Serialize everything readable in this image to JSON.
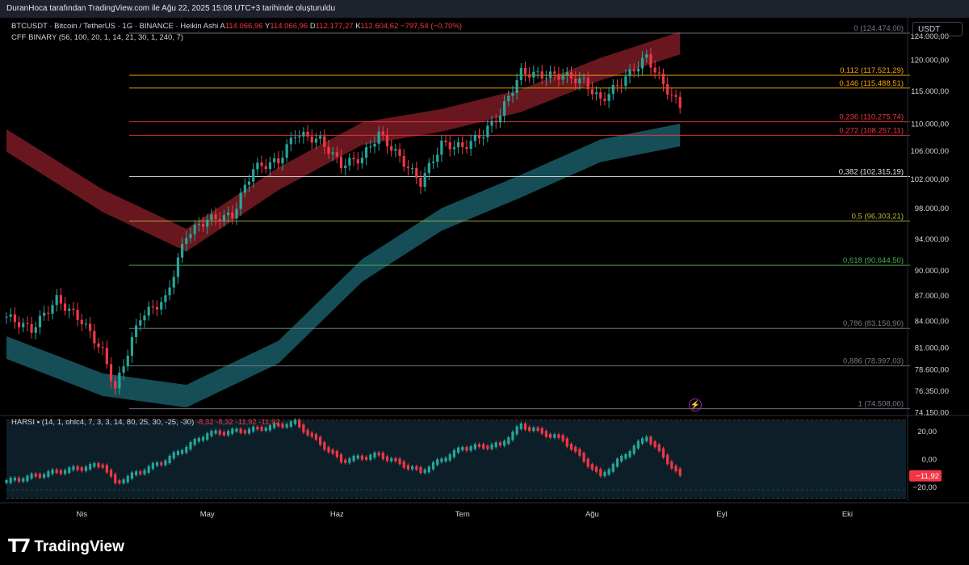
{
  "header": {
    "publisher_line": "DuranHoca tarafından TradingView.com ile Ağu 22, 2025 15:08 UTC+3 tarihinde oluşturuldu"
  },
  "legend": {
    "symbol": "BTCUSDT · Bitcoin / TetherUS · 1G · BINANCE · Heikin Ashi",
    "open_label": "A",
    "open_value": "114.066,96",
    "high_label": "Y",
    "high_value": "114.066,96",
    "low_label": "D",
    "low_value": "112.177,27",
    "close_label": "K",
    "close_value": "112.604,62",
    "change": "−797,54 (−0,70%)",
    "indicator": "CFF BINARY (56, 100, 20, 1, 14, 21, 30, 1, 240, 7)"
  },
  "oscillator_legend": {
    "name": "HARSI",
    "params": "(14, 1, ohlc4, 7, 3, 3, 14, 80, 25, 30, -25, -30)",
    "values": [
      "-8,32",
      "-8,32",
      "-11,92",
      "-11,92"
    ]
  },
  "currency_button": "USDT",
  "price_axis": [
    "124.000,00",
    "120.000,00",
    "115.000,00",
    "110.000,00",
    "106.000,00",
    "102.000,00",
    "98.000,00",
    "94.000,00",
    "90.000,00",
    "87.000,00",
    "84.000,00",
    "81.000,00",
    "78.600,00",
    "76.350,00",
    "74.150,00"
  ],
  "price_axis_values": [
    124000,
    120000,
    115000,
    110000,
    106000,
    102000,
    98000,
    94000,
    90000,
    87000,
    84000,
    81000,
    78600,
    76350,
    74150
  ],
  "osc_axis": [
    "20,00",
    "0,00",
    "−20,00"
  ],
  "osc_axis_values": [
    20,
    0,
    -20
  ],
  "osc_current_label": "−11,92",
  "osc_current_value": -11.92,
  "time_axis": [
    "Nis",
    "May",
    "Haz",
    "Tem",
    "Ağu",
    "Eyl",
    "Eki"
  ],
  "fib_levels": [
    {
      "label": "0 (124.474,00)",
      "price": 124474,
      "color": "#787b86"
    },
    {
      "label": "0,112 (117.521,29)",
      "price": 117521.29,
      "color": "#f7a600"
    },
    {
      "label": "0,146 (115.488,51)",
      "price": 115488.51,
      "color": "#f7a600"
    },
    {
      "label": "0,236 (110.275,74)",
      "price": 110275.74,
      "color": "#f23645"
    },
    {
      "label": "0,272 (108.257,11)",
      "price": 108257.11,
      "color": "#f23645"
    },
    {
      "label": "0,382 (102.315,19)",
      "price": 102315.19,
      "color": "#e0e0e0"
    },
    {
      "label": "0,5 (96.303,21)",
      "price": 96303.21,
      "color": "#b2b536"
    },
    {
      "label": "0,618 (90.644,50)",
      "price": 90644.5,
      "color": "#4caf50"
    },
    {
      "label": "0,786 (83.156,90)",
      "price": 83156.9,
      "color": "#787b86"
    },
    {
      "label": "0,886 (78.997,03)",
      "price": 78997.03,
      "color": "#787b86"
    },
    {
      "label": "1 (74.508,00)",
      "price": 74508,
      "color": "#787b86"
    }
  ],
  "colors": {
    "up": "#26a69a",
    "down": "#f23645",
    "upper_band": "#7a1b24",
    "lower_band": "#1a5c66",
    "background": "#000000"
  },
  "brand": {
    "name": "TradingView"
  },
  "chart_data": {
    "type": "candlestick",
    "timeframe": "1D",
    "chart_style": "Heikin Ashi",
    "y_scale": "log",
    "y_range": [
      74150,
      126000
    ],
    "x_range": [
      "2025-03-14",
      "2025-10-15"
    ],
    "x": [
      "2025-03-14",
      "2025-03-20",
      "2025-03-26",
      "2025-04-01",
      "2025-04-06",
      "2025-04-09",
      "2025-04-15",
      "2025-04-21",
      "2025-04-26",
      "2025-05-01",
      "2025-05-07",
      "2025-05-12",
      "2025-05-18",
      "2025-05-22",
      "2025-05-28",
      "2025-06-02",
      "2025-06-07",
      "2025-06-11",
      "2025-06-16",
      "2025-06-21",
      "2025-06-26",
      "2025-07-01",
      "2025-07-06",
      "2025-07-10",
      "2025-07-15",
      "2025-07-20",
      "2025-07-25",
      "2025-07-30",
      "2025-08-03",
      "2025-08-08",
      "2025-08-14",
      "2025-08-18",
      "2025-08-22"
    ],
    "close": [
      84500,
      83000,
      86500,
      84000,
      80500,
      76500,
      84500,
      86500,
      94500,
      96500,
      97000,
      103500,
      104500,
      108500,
      107500,
      104000,
      105000,
      108500,
      105000,
      101500,
      107000,
      106500,
      108500,
      111500,
      118000,
      117500,
      117500,
      116500,
      113500,
      116500,
      120500,
      116000,
      112600
    ],
    "upper_band_mid": [
      {
        "x": "2025-03-14",
        "y": 107500
      },
      {
        "x": "2025-04-06",
        "y": 99000
      },
      {
        "x": "2025-04-26",
        "y": 93800
      },
      {
        "x": "2025-05-18",
        "y": 102000
      },
      {
        "x": "2025-06-07",
        "y": 108500
      },
      {
        "x": "2025-06-26",
        "y": 110500
      },
      {
        "x": "2025-07-15",
        "y": 113500
      },
      {
        "x": "2025-08-03",
        "y": 118500
      },
      {
        "x": "2025-08-22",
        "y": 122800
      }
    ],
    "lower_band_mid": [
      {
        "x": "2025-03-14",
        "y": 81000
      },
      {
        "x": "2025-04-06",
        "y": 77000
      },
      {
        "x": "2025-04-26",
        "y": 75800
      },
      {
        "x": "2025-05-18",
        "y": 80500
      },
      {
        "x": "2025-06-07",
        "y": 90000
      },
      {
        "x": "2025-06-26",
        "y": 96500
      },
      {
        "x": "2025-07-15",
        "y": 101000
      },
      {
        "x": "2025-08-03",
        "y": 106000
      },
      {
        "x": "2025-08-22",
        "y": 108300
      }
    ],
    "oscillator": {
      "name": "HARSI",
      "y_range": [
        -30,
        30
      ],
      "x": [
        "2025-03-14",
        "2025-03-26",
        "2025-04-06",
        "2025-04-09",
        "2025-04-21",
        "2025-05-01",
        "2025-05-12",
        "2025-05-22",
        "2025-06-02",
        "2025-06-11",
        "2025-06-21",
        "2025-07-01",
        "2025-07-10",
        "2025-07-15",
        "2025-07-25",
        "2025-08-03",
        "2025-08-14",
        "2025-08-22"
      ],
      "values": [
        -16,
        -9,
        -4,
        -17,
        -1,
        18,
        21,
        26,
        -1,
        3,
        -9,
        8,
        10,
        24,
        14,
        -12,
        16,
        -12
      ]
    }
  }
}
